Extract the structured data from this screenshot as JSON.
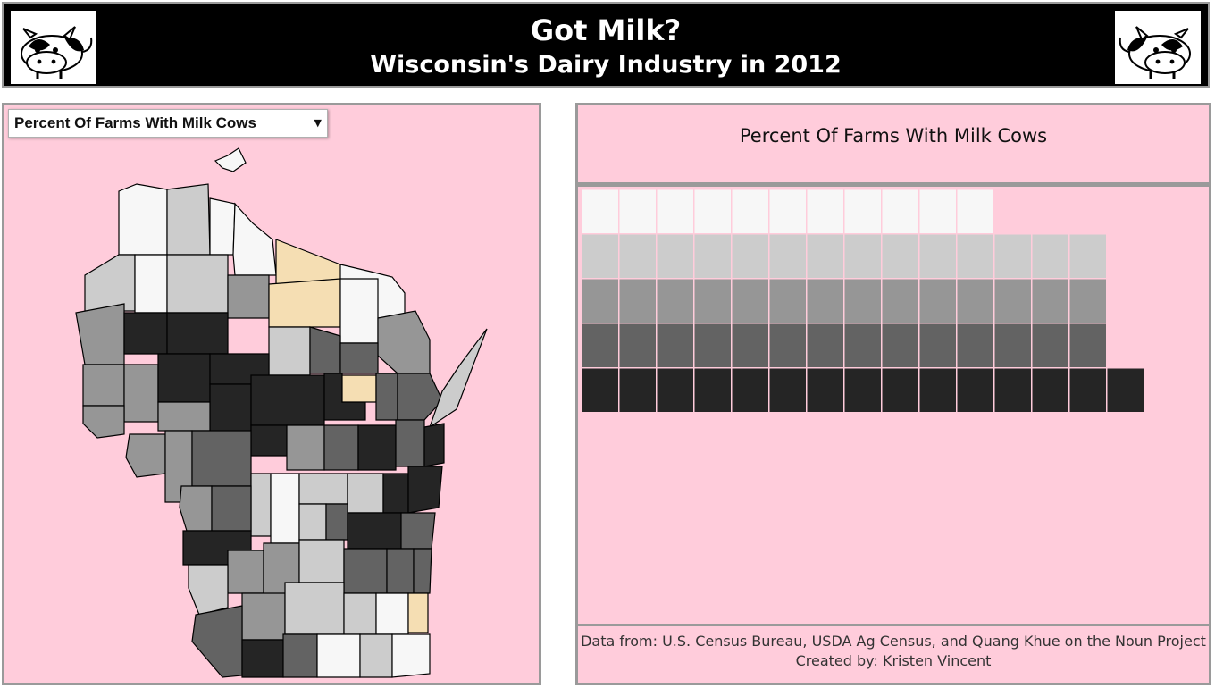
{
  "header": {
    "title": "Got Milk?",
    "subtitle": "Wisconsin's Dairy Industry in 2012",
    "logo_icon": "cow-icon"
  },
  "controls": {
    "attribute_select": {
      "selected": "Percent Of Farms With Milk Cows"
    }
  },
  "chart": {
    "title": "Percent Of Farms With Milk Cows"
  },
  "footer": {
    "credits_line1": "Data from: U.S. Census Bureau, USDA Ag Census, and Quang Khue on the Noun Project",
    "credits_line2": "Created by: Kristen Vincent"
  },
  "colors": {
    "background": "#ffccdb",
    "header_bg": "#000000",
    "class1": "#f7f7f7",
    "class2": "#cccccc",
    "class3": "#969696",
    "class4": "#636363",
    "class5": "#252525",
    "no_data": "#f5deb3"
  },
  "chart_data": {
    "type": "table",
    "description_rows": [
      {
        "class": 1,
        "count": 11
      },
      {
        "class": 2,
        "count": 14
      },
      {
        "class": 3,
        "count": 14
      },
      {
        "class": 4,
        "count": 14
      },
      {
        "class": 5,
        "count": 15
      }
    ],
    "no_data_counties": 4
  }
}
